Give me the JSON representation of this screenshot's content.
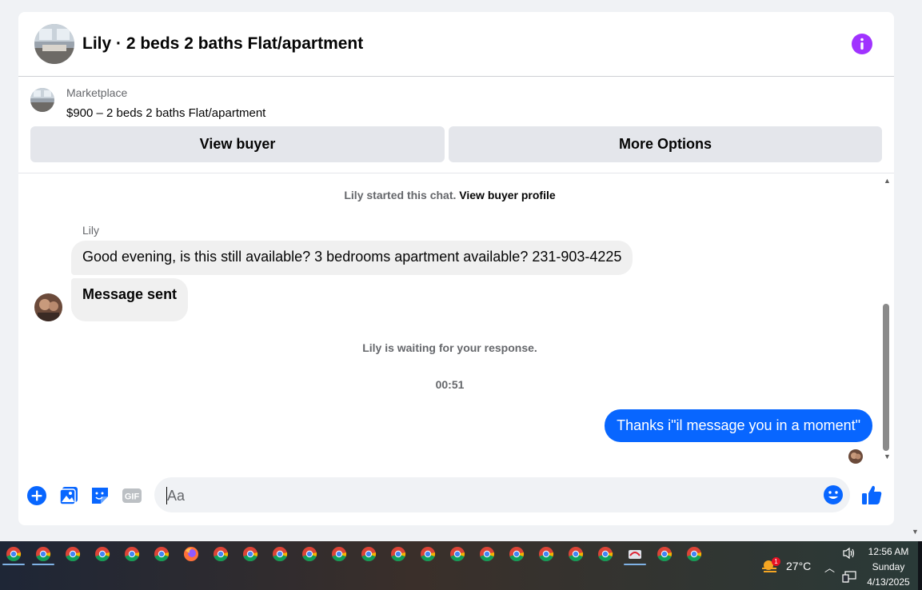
{
  "header": {
    "title": "Lily · 2 beds 2 baths Flat/apartment"
  },
  "marketplace": {
    "kicker": "Marketplace",
    "listing": "$900 – 2 beds 2 baths Flat/apartment",
    "view_buyer_label": "View buyer",
    "more_options_label": "More Options"
  },
  "thread": {
    "started_prefix": "Lily started this chat.",
    "started_link": "View buyer profile",
    "sender_name": "Lily",
    "incoming": [
      "Good evening, is this still available? 3 bedrooms apartment available? 231-903-4225",
      "Message sent"
    ],
    "waiting": "Lily is waiting for your response.",
    "timestamp": "00:51",
    "outgoing": "Thanks i\"il message you in a moment\""
  },
  "composer": {
    "placeholder": "Aa",
    "tools": [
      "plus-circle-icon",
      "photo-icon",
      "sticker-icon",
      "gif-icon"
    ],
    "gif_label": "GIF"
  },
  "taskbar": {
    "apps": [
      "chrome",
      "chrome",
      "chrome",
      "chrome",
      "chrome",
      "chrome",
      "firefox",
      "chrome",
      "chrome",
      "chrome",
      "chrome",
      "chrome",
      "chrome",
      "chrome",
      "chrome",
      "chrome",
      "chrome",
      "chrome",
      "chrome",
      "chrome",
      "chrome",
      "app",
      "chrome",
      "chrome"
    ],
    "weather_badge": "1",
    "temperature": "27°C",
    "time": "12:56 AM",
    "day": "Sunday",
    "date": "4/13/2025"
  },
  "colors": {
    "accent_blue": "#0866ff",
    "info_purple": "#a033ff",
    "bubble_gray": "#f0f0f0"
  }
}
